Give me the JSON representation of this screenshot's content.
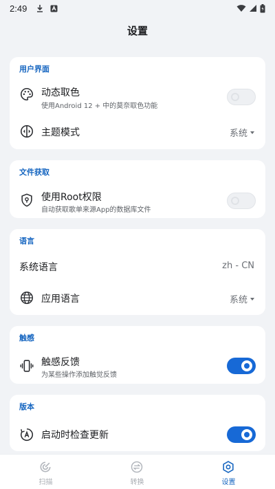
{
  "status_bar": {
    "time": "2:49"
  },
  "page": {
    "title": "设置"
  },
  "sections": {
    "ui": {
      "header": "用户界面",
      "dynamic_color": {
        "title": "动态取色",
        "subtitle": "使用Android 12 + 中的莫奈取色功能",
        "enabled": false
      },
      "theme_mode": {
        "title": "主题模式",
        "value": "系统"
      }
    },
    "file": {
      "header": "文件获取",
      "root": {
        "title": "使用Root权限",
        "subtitle": "自动获取歌单来源App的数据库文件",
        "enabled": false
      }
    },
    "language": {
      "header": "语言",
      "system_language": {
        "title": "系统语言",
        "value": "zh - CN"
      },
      "app_language": {
        "title": "应用语言",
        "value": "系统"
      }
    },
    "haptics": {
      "header": "触感",
      "haptic_feedback": {
        "title": "触感反馈",
        "subtitle": "为某些操作添加触觉反馈",
        "enabled": true
      }
    },
    "version": {
      "header": "版本",
      "check_update": {
        "title": "启动时检查更新",
        "enabled": true
      }
    }
  },
  "bottom_nav": {
    "items": [
      {
        "label": "扫描",
        "icon": "scan-icon",
        "active": false
      },
      {
        "label": "转换",
        "icon": "convert-icon",
        "active": false
      },
      {
        "label": "设置",
        "icon": "settings-icon",
        "active": true
      }
    ]
  },
  "colors": {
    "accent": "#1769d6",
    "header_text": "#1565c0",
    "background": "#f1f3f6",
    "card": "#ffffff"
  }
}
